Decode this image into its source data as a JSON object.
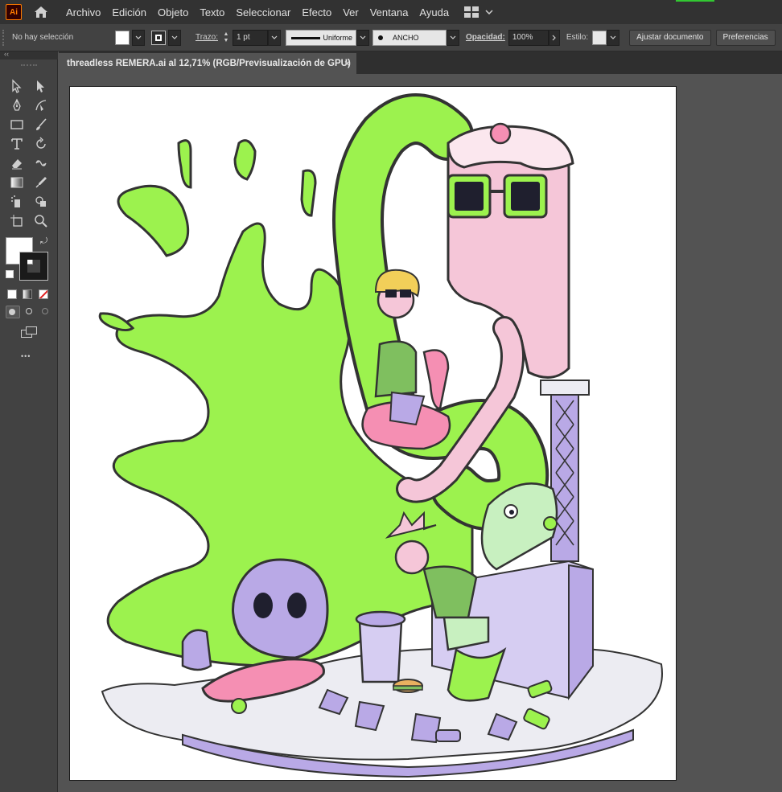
{
  "app": {
    "logo_text": "Ai"
  },
  "menu": [
    "Archivo",
    "Edición",
    "Objeto",
    "Texto",
    "Seleccionar",
    "Efecto",
    "Ver",
    "Ventana",
    "Ayuda"
  ],
  "control_bar": {
    "selection_status": "No hay selección",
    "stroke_label": "Trazo:",
    "stroke_value": "1 pt",
    "profile_label": "Uniforme",
    "brush_label": "ANCHO",
    "opacity_label": "Opacidad:",
    "opacity_value": "100%",
    "style_label": "Estilo:",
    "adjust_doc_button": "Ajustar documento",
    "preferences_button": "Preferencias"
  },
  "document": {
    "tab_title": "threadless REMERA.ai al 12,71% (RGB/Previsualización de GPU)",
    "close_glyph": "×"
  },
  "toolbar": {
    "more_glyph": "•••"
  },
  "colors": {
    "app_bg": "#535353",
    "panel": "#424242",
    "menubar": "#323232",
    "slime": "#9cf24e",
    "skin_pink": "#f5c6d8",
    "lavender": "#b9a9e6",
    "outline": "#333333"
  }
}
